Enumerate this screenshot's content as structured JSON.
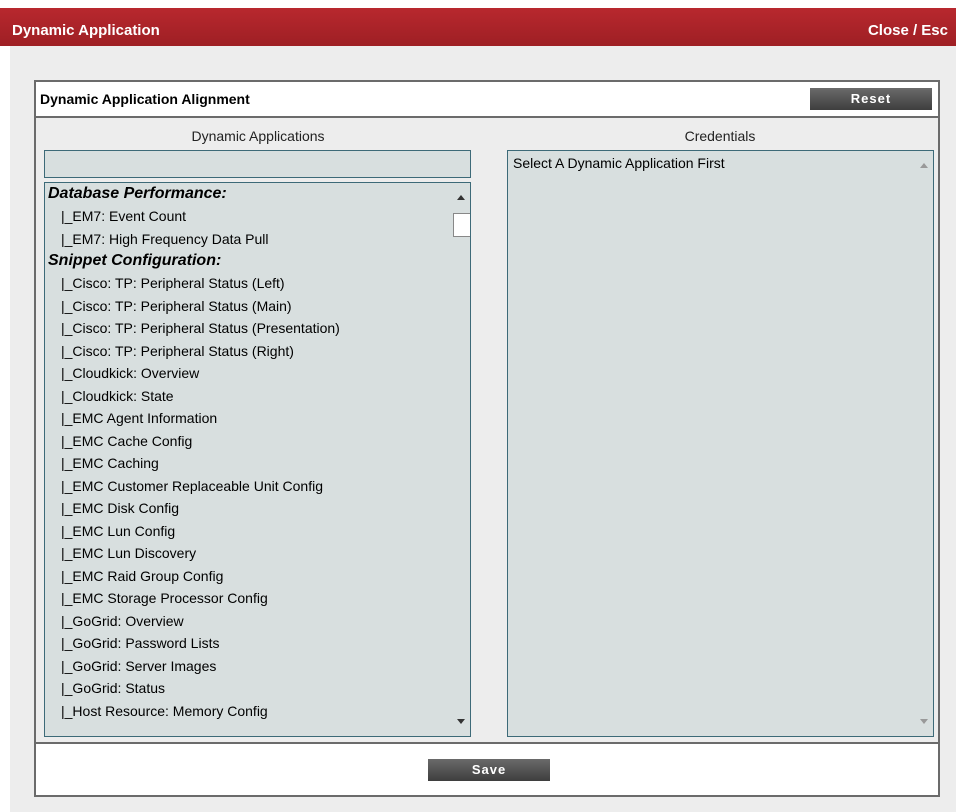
{
  "window": {
    "title": "Dynamic Application",
    "close_label": "Close / Esc"
  },
  "panel": {
    "title": "Dynamic Application Alignment",
    "reset_label": "Reset",
    "save_label": "Save"
  },
  "apps": {
    "header": "Dynamic Applications",
    "filter_value": "",
    "groups": [
      {
        "name": "Database Performance:",
        "items": [
          "|_EM7: Event Count",
          "|_EM7: High Frequency Data Pull"
        ]
      },
      {
        "name": "Snippet Configuration:",
        "items": [
          "|_Cisco: TP: Peripheral Status (Left)",
          "|_Cisco: TP: Peripheral Status (Main)",
          "|_Cisco: TP: Peripheral Status (Presentation)",
          "|_Cisco: TP: Peripheral Status (Right)",
          "|_Cloudkick: Overview",
          "|_Cloudkick: State",
          "|_EMC Agent Information",
          "|_EMC Cache Config",
          "|_EMC Caching",
          "|_EMC Customer Replaceable Unit Config",
          "|_EMC Disk Config",
          "|_EMC Lun Config",
          "|_EMC Lun Discovery",
          "|_EMC Raid Group Config",
          "|_EMC Storage Processor Config",
          "|_GoGrid: Overview",
          "|_GoGrid: Password Lists",
          "|_GoGrid: Server Images",
          "|_GoGrid: Status",
          "|_Host Resource: Memory Config"
        ]
      }
    ]
  },
  "credentials": {
    "header": "Credentials",
    "placeholder_text": "Select A Dynamic Application First"
  },
  "colors": {
    "titlebar": "#a52227",
    "list_bg": "#d8dfdf",
    "list_border": "#3d6a78",
    "button_bg": "#4a4a4a"
  }
}
